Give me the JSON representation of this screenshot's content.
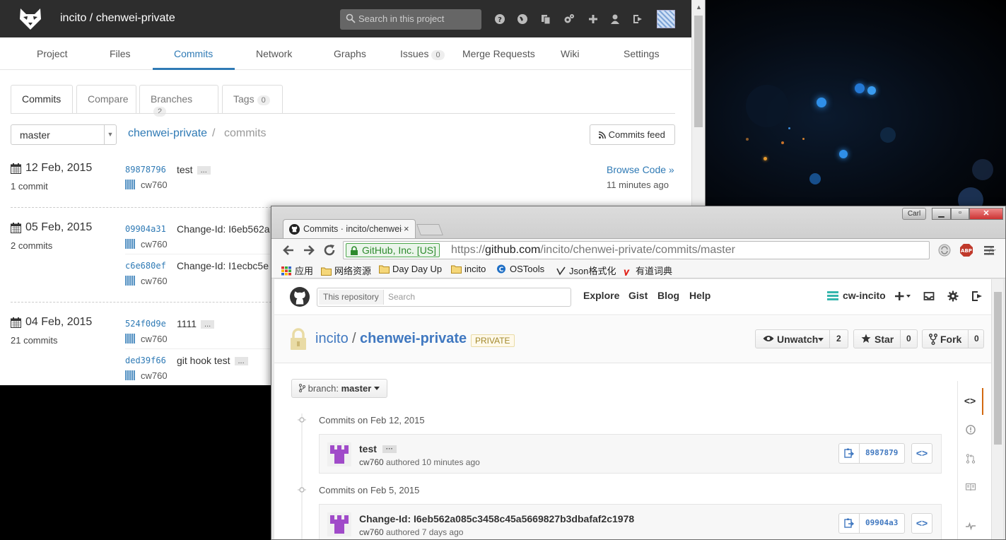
{
  "gitlab": {
    "title": "incito / chenwei-private",
    "search_placeholder": "Search in this project",
    "nav": [
      {
        "label": "Project"
      },
      {
        "label": "Files"
      },
      {
        "label": "Commits"
      },
      {
        "label": "Network"
      },
      {
        "label": "Graphs"
      },
      {
        "label": "Issues",
        "count": "0"
      },
      {
        "label": "Merge Requests"
      },
      {
        "label": "Wiki"
      },
      {
        "label": "Settings"
      }
    ],
    "tabs": [
      {
        "label": "Commits"
      },
      {
        "label": "Compare"
      },
      {
        "label": "Branches",
        "count": "2"
      },
      {
        "label": "Tags",
        "count": "0"
      }
    ],
    "branch": "master",
    "breadcrumb": {
      "repo": "chenwei-private",
      "sep": "/",
      "page": "commits"
    },
    "feed_label": "Commits feed",
    "days": [
      {
        "date": "12 Feb, 2015",
        "count": "1 commit",
        "commits": [
          {
            "sha": "89878796",
            "message": "test",
            "more": "...",
            "author": "cw760"
          }
        ]
      },
      {
        "date": "05 Feb, 2015",
        "count": "2 commits",
        "commits": [
          {
            "sha": "09904a31",
            "message": "Change-Id: I6eb562a",
            "author": "cw760"
          },
          {
            "sha": "c6e680ef",
            "message": "Change-Id: I1ecbc5e",
            "author": "cw760"
          }
        ]
      },
      {
        "date": "04 Feb, 2015",
        "count": "21 commits",
        "commits": [
          {
            "sha": "524f0d9e",
            "message": "1111",
            "more": "...",
            "author": "cw760"
          },
          {
            "sha": "ded39f66",
            "message": "git hook test",
            "more": "...",
            "author": "cw760"
          }
        ]
      }
    ],
    "browse_code": "Browse Code »",
    "time_ago": "11 minutes ago"
  },
  "chrome": {
    "tab_title": "Commits · incito/chenwei-private",
    "tab_close": "×",
    "user_button": "Carl",
    "ev_label": "GitHub, Inc. [US]",
    "url": {
      "scheme": "https://",
      "host": "github.com",
      "path": "/incito/chenwei-private/commits/master"
    },
    "bookmarks": [
      {
        "label": "应用",
        "icon": "apps-grid-icon"
      },
      {
        "label": "网络资源",
        "icon": "folder-icon"
      },
      {
        "label": "Day Day Up",
        "icon": "folder-icon"
      },
      {
        "label": "incito",
        "icon": "folder-icon"
      },
      {
        "label": "OSTools",
        "icon": "ostools-icon"
      },
      {
        "label": "Json格式化",
        "icon": "json-icon"
      },
      {
        "label": "有道词典",
        "icon": "youdao-icon"
      }
    ]
  },
  "github": {
    "search_scope": "This repository",
    "search_placeholder": "Search",
    "nav": [
      "Explore",
      "Gist",
      "Blog",
      "Help"
    ],
    "user": "cw-incito",
    "owner": "incito",
    "slash": "/",
    "repo": "chenwei-private",
    "private_label": "PRIVATE",
    "unwatch": {
      "label": "Unwatch",
      "count": "2"
    },
    "star": {
      "label": "Star",
      "count": "0"
    },
    "fork": {
      "label": "Fork",
      "count": "0"
    },
    "branch_prefix": "branch:",
    "branch": "master",
    "day_groups": [
      {
        "heading": "Commits on Feb 12, 2015",
        "commit": {
          "title": "test",
          "dots": "···",
          "author": "cw760",
          "authored": "authored 10 minutes ago",
          "sha": "8987879"
        }
      },
      {
        "heading": "Commits on Feb 5, 2015",
        "commit": {
          "title": "Change-Id: I6eb562a085c3458c45a5669827b3dbafaf2c1978",
          "author": "cw760",
          "authored": "authored 7 days ago",
          "sha": "09904a3"
        }
      }
    ],
    "browse_symbol": "<>"
  },
  "colors": {
    "gitlab_header": "#2d2d2d",
    "gitlab_accent": "#2f7ab5",
    "github_link": "#4078c0",
    "github_private": "#a1882b",
    "ev_green": "#2e8b2e"
  }
}
